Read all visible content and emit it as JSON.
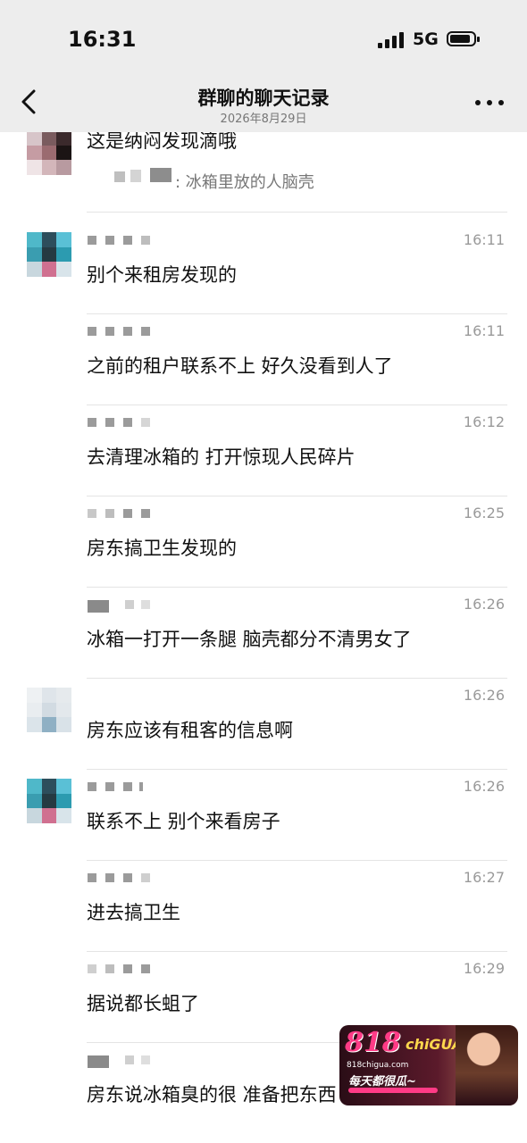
{
  "status": {
    "time": "16:31",
    "network": "5G"
  },
  "header": {
    "title": "群聊的聊天记录",
    "subtitle": "2026年8月29日"
  },
  "messages": [
    {
      "time": "",
      "text": "这是纳闷发现滴哦",
      "quote": ": 冰箱里放的人脑壳"
    },
    {
      "time": "16:11",
      "text": "别个来租房发现的"
    },
    {
      "time": "16:11",
      "text": "之前的租户联系不上 好久没看到人了"
    },
    {
      "time": "16:12",
      "text": "去清理冰箱的 打开惊现人民碎片"
    },
    {
      "time": "16:25",
      "text": "房东搞卫生发现的"
    },
    {
      "time": "16:26",
      "text": "冰箱一打开一条腿 脑壳都分不清男女了"
    },
    {
      "time": "16:26",
      "text": "房东应该有租客的信息啊"
    },
    {
      "time": "16:26",
      "text": "联系不上 别个来看房子"
    },
    {
      "time": "16:27",
      "text": "进去搞卫生"
    },
    {
      "time": "16:29",
      "text": "据说都长蛆了"
    },
    {
      "time": "",
      "text": "房东说冰箱臭的很 准备把东西"
    }
  ],
  "watermark": {
    "logo_number": "818",
    "logo_text": "chiGUA",
    "url": "818chigua.com",
    "slogan": "每天都很瓜~"
  },
  "icons": {
    "back": "chevron-left-icon",
    "more": "more-dots-icon",
    "signal": "signal-bars-icon",
    "battery": "battery-icon"
  }
}
